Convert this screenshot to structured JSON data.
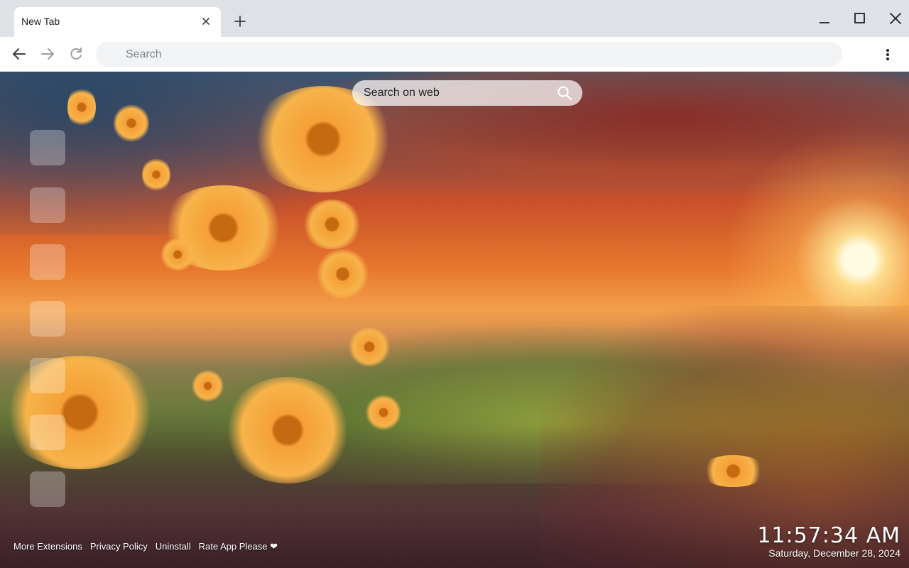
{
  "browser": {
    "tab_title": "New Tab",
    "omnibox_placeholder": "Search"
  },
  "page": {
    "web_search_placeholder": "Search on web",
    "footer_links": [
      "More Extensions",
      "Privacy Policy",
      "Uninstall",
      "Rate App Please ❤"
    ],
    "clock_time": "11:57:34 AM",
    "clock_date": "Saturday, December 28, 2024",
    "background": "sunset meadow with orange flowers"
  },
  "icons": {
    "tab_close": "close-icon",
    "new_tab": "plus-icon",
    "minimize": "minimize-icon",
    "maximize": "maximize-icon",
    "window_close": "close-icon",
    "back": "arrow-left-icon",
    "forward": "arrow-right-icon",
    "reload": "reload-icon",
    "menu": "kebab-menu-icon",
    "search": "search-icon"
  },
  "colors": {
    "tabstrip": "#dee1e6",
    "omnibox": "#f1f3f4",
    "forward_disabled": "#9aa0a6"
  }
}
